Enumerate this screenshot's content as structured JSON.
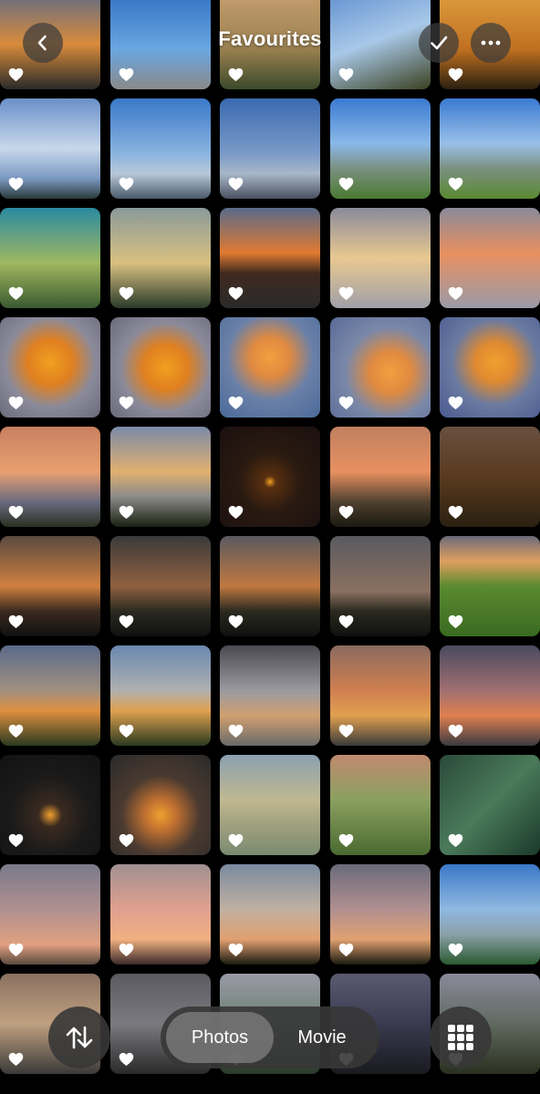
{
  "header": {
    "title": "Favourites",
    "back_icon": "chevron-left-icon",
    "select_icon": "checkmark-icon",
    "more_icon": "ellipsis-icon"
  },
  "bottom_bar": {
    "sort_icon": "sort-arrows-icon",
    "tabs": [
      {
        "label": "Photos",
        "active": true
      },
      {
        "label": "Movie",
        "active": false
      }
    ],
    "grid_icon": "grid-icon"
  },
  "photos": [
    {
      "bg": "linear-gradient(180deg,#5a6a8a 0%,#d98b3a 55%,#2a2a2a 100%)"
    },
    {
      "bg": "linear-gradient(180deg,#2f6fc0 0%,#6aa6e0 60%,#8a8a8a 100%)"
    },
    {
      "bg": "linear-gradient(180deg,#c8a070 0%,#9a8050 60%,#3a4a2a 100%)"
    },
    {
      "bg": "linear-gradient(160deg,#5f8fd0 0%,#a8c8e8 50%,#3a4020 100%)"
    },
    {
      "bg": "linear-gradient(180deg,#e0a040 0%,#c07020 60%,#2a2010 100%)"
    },
    {
      "bg": "linear-gradient(180deg,#6a90c8 0%,#c8d8ec 50%,#7a98c0 80%,#2a3a3a 100%)"
    },
    {
      "bg": "linear-gradient(180deg,#3a78c8 0%,#8ab4e0 55%,#b8c8d8 75%,#4a5a6a 100%)"
    },
    {
      "bg": "linear-gradient(180deg,#3a6ab0 0%,#7a9ac8 55%,#a8b8c8 75%,#4a5060 100%)"
    },
    {
      "bg": "linear-gradient(180deg,#3a7ad0 0%,#8ab8e8 45%,#7a9080 70%,#4a7a30 100%)"
    },
    {
      "bg": "linear-gradient(180deg,#3a7ad0 0%,#9ac0e8 45%,#7a9080 70%,#5a8a30 100%)"
    },
    {
      "bg": "linear-gradient(180deg,#2a8aa0 0%,#a0b860 55%,#3a5a30 100%)"
    },
    {
      "bg": "linear-gradient(180deg,#8a9a9a 0%,#d8c080 55%,#2a3a2a 100%)"
    },
    {
      "bg": "linear-gradient(180deg,#5a6a8a 0%,#e07a30 45%,#402a20 65%,#2a2a2a 100%)"
    },
    {
      "bg": "linear-gradient(180deg,#8a8a9a 0%,#e8c890 50%,#a0a0a8 100%)"
    },
    {
      "bg": "linear-gradient(180deg,#8a8a9a 0%,#e89060 45%,#9a9aa8 100%)"
    },
    {
      "bg": "radial-gradient(circle at 50% 45%,#f0a020 0%,#e08020 30%,#8a8a9a 60%,#6a6a7a 100%)"
    },
    {
      "bg": "radial-gradient(circle at 55% 50%,#f0a020 0%,#e08020 30%,#8a8a9a 60%,#6a6a7a 100%)"
    },
    {
      "bg": "radial-gradient(circle at 50% 40%,#f0a040 0%,#e08a40 25%,#6a80a8 55%,#4a6a98 100%)"
    },
    {
      "bg": "radial-gradient(circle at 60% 55%,#f0a040 0%,#e08a40 25%,#7a88a8 55%,#5a6a98 100%)"
    },
    {
      "bg": "radial-gradient(circle at 55% 45%,#f0a030 0%,#e08a30 25%,#6a7aa0 55%,#4a5a90 100%)"
    },
    {
      "bg": "linear-gradient(180deg,#c88060 0%,#e8a070 45%,#6a6a80 75%,#2a3020 100%)"
    },
    {
      "bg": "linear-gradient(180deg,#7a8aa8 0%,#e0b070 45%,#8a8a8a 70%,#1a2010 100%)"
    },
    {
      "bg": "radial-gradient(circle at 50% 55%,#f0a020 0%,#5a3010 8%,#2a1a10 40%,#1a1010 100%)"
    },
    {
      "bg": "linear-gradient(180deg,#c08060 0%,#e89060 45%,#504030 75%,#1a1a10 100%)"
    },
    {
      "bg": "linear-gradient(180deg,#6a5040 0%,#5a3a20 50%,#2a2010 100%)"
    },
    {
      "bg": "linear-gradient(180deg,#5a4a40 0%,#d08040 50%,#3a2a20 75%,#101010 100%)"
    },
    {
      "bg": "linear-gradient(180deg,#3a3a3a 0%,#906040 50%,#2a2a20 75%,#101010 100%)"
    },
    {
      "bg": "linear-gradient(180deg,#5a5a60 0%,#c07840 50%,#2a2a20 75%,#101010 100%)"
    },
    {
      "bg": "linear-gradient(180deg,#5a5a60 0%,#8a7060 55%,#2a2a20 75%,#101010 100%)"
    },
    {
      "bg": "linear-gradient(180deg,#6a6a7a 0%,#e0a060 25%,#5a8a30 50%,#3a6a20 100%)"
    },
    {
      "bg": "linear-gradient(180deg,#5a6a8a 0%,#a09080 45%,#e09040 65%,#2a3a20 100%)"
    },
    {
      "bg": "linear-gradient(180deg,#6a88b0 0%,#b0b0b0 45%,#e0a050 65%,#2a3a20 100%)"
    },
    {
      "bg": "linear-gradient(180deg,#4a4a50 0%,#9a9aa0 45%,#d0a070 70%,#6a6a6a 100%)"
    },
    {
      "bg": "linear-gradient(180deg,#8a6a60 0%,#d08050 45%,#e0a050 70%,#3a3a3a 100%)"
    },
    {
      "bg": "linear-gradient(180deg,#4a4a60 0%,#a07070 45%,#e08050 70%,#3a3a40 100%)"
    },
    {
      "bg": "radial-gradient(circle at 50% 60%,#f0a030 0%,#3a2a20 15%,#1a1a1a 50%,#121212 100%)"
    },
    {
      "bg": "radial-gradient(circle at 50% 60%,#f0a030 0%,#c07030 20%,#4a3a30 50%,#2a2a2a 100%)"
    },
    {
      "bg": "linear-gradient(180deg,#8aa0b0 0%,#c0b890 45%,#a0a080 70%,#7a8a70 100%)"
    },
    {
      "bg": "linear-gradient(180deg,#c08a70 0%,#8aa060 45%,#4a6a30 100%)"
    },
    {
      "bg": "linear-gradient(135deg,#2a4a3a 0%,#4a7a5a 50%,#1a3a2a 100%)"
    },
    {
      "bg": "linear-gradient(180deg,#7a7a8a 0%,#b09090 45%,#e0a080 80%,#5a4a40 100%)"
    },
    {
      "bg": "linear-gradient(180deg,#a09090 0%,#e0a090 45%,#f0b080 75%,#3a2a2a 100%)"
    },
    {
      "bg": "linear-gradient(180deg,#7a8aa0 0%,#c0b0a0 45%,#e0a070 75%,#1a1a10 100%)"
    },
    {
      "bg": "linear-gradient(180deg,#6a6a7a 0%,#b09090 45%,#e0a070 75%,#1a1a10 100%)"
    },
    {
      "bg": "linear-gradient(180deg,#3a78c8 0%,#90b8e0 45%,#8aa0a8 70%,#2a5a30 100%)"
    },
    {
      "bg": "linear-gradient(180deg,#8a7060 0%,#c0a080 50%,#3a3a3a 100%)"
    },
    {
      "bg": "linear-gradient(180deg,#5a5a60 0%,#7a7a80 50%,#2a2a2a 100%)"
    },
    {
      "bg": "linear-gradient(180deg,#9a9aa8 0%,#6a8070 50%,#2a3a2a 100%)"
    },
    {
      "bg": "linear-gradient(180deg,#5a5a70 0%,#3a3a50 50%,#1a1a20 100%)"
    },
    {
      "bg": "linear-gradient(180deg,#8a8a9a 0%,#606a60 50%,#2a3020 100%)"
    }
  ]
}
